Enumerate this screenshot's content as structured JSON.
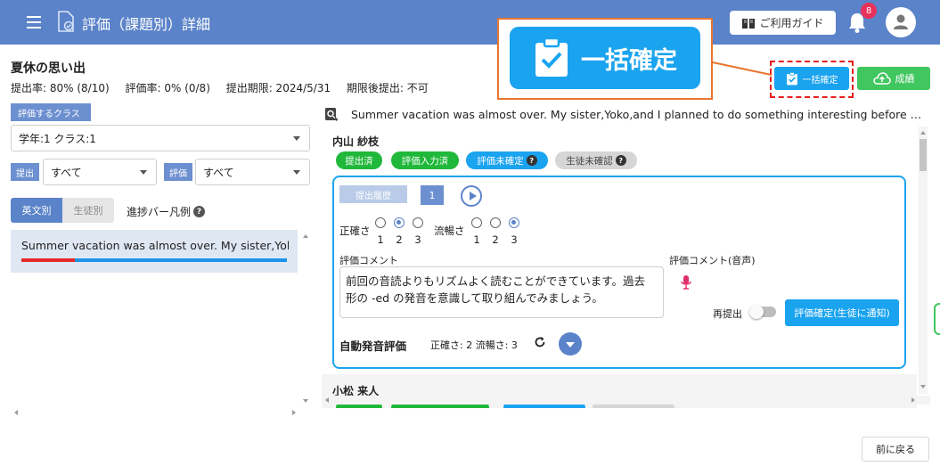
{
  "header": {
    "title": "評価（課題別）詳細",
    "guide_label": "ご利用ガイド",
    "notification_count": "8",
    "bg_color": "#5b83c9"
  },
  "callout": {
    "label": "一括確定"
  },
  "assignment": {
    "title": "夏休の思い出",
    "submission_rate": "提出率: 80% (8/10)",
    "evaluation_rate": "評価率: 0% (0/8)",
    "deadline": "提出期限: 2024/5/31",
    "late_submission": "期限後提出: 不可"
  },
  "actions": {
    "bulk_confirm": "一括確定",
    "grades": "成績",
    "back": "前に戻る"
  },
  "filters": {
    "class_label": "評価するクラス",
    "class_value": "学年:1 クラス:1",
    "submission_label": "提出",
    "submission_value": "すべて",
    "evaluation_label": "評価",
    "evaluation_value": "すべて"
  },
  "tabs": {
    "by_sentence": "英文別",
    "by_student": "生徒別",
    "legend": "進捗バー凡例"
  },
  "sentence_list": [
    {
      "text": "Summer vacation was almost over. My sister,Yoko,and I planned to do something interesting before school started.",
      "progress_done": 0.2
    }
  ],
  "essay_line": "Summer vacation was almost over. My sister,Yoko,and I planned to do something interesting before school started.",
  "student1": {
    "name": "内山 紗枝",
    "statuses": [
      "提出済",
      "評価入力済",
      "評価未確定",
      "生徒未確認"
    ],
    "history_label": "提出履歴",
    "history_number": "1",
    "accuracy_label": "正確さ",
    "fluency_label": "流暢さ",
    "scale": [
      "1",
      "2",
      "3"
    ],
    "accuracy_score": 2,
    "fluency_score": 3,
    "comment_label": "評価コメント",
    "comment_line1": "前回の音読よりもリズムよく読むことができています。過去",
    "comment_line2": "形の -ed の発音を意識して取り組んでみましょう。",
    "voice_comment_label": "評価コメント(音声)",
    "resubmit_label": "再提出",
    "confirm_label": "評価確定(生徒に通知)",
    "auto_title": "自動発音評価",
    "auto_scores": "正確さ: 2  流暢さ: 3"
  },
  "student2": {
    "name": "小松 来人"
  },
  "icons": [
    "hamburger-icon",
    "document-icon",
    "book-icon",
    "bell-icon",
    "user-icon",
    "clipboard-check-icon",
    "cloud-upload-icon",
    "search-icon",
    "play-icon",
    "mic-icon",
    "refresh-icon",
    "chevron-down-icon",
    "question-icon"
  ]
}
